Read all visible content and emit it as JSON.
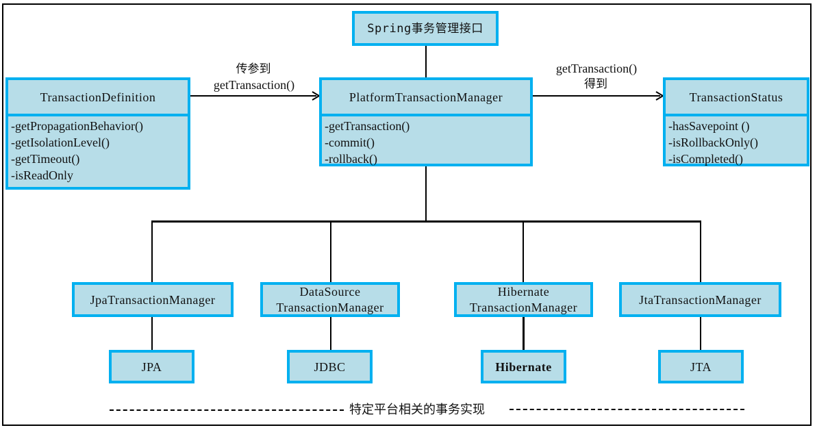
{
  "diagram": {
    "top_box": {
      "label": "Spring事务管理接口"
    },
    "definition": {
      "title": "TransactionDefinition",
      "members": [
        "-getPropagationBehavior()",
        "-getIsolationLevel()",
        "-getTimeout()",
        "-isReadOnly"
      ]
    },
    "manager": {
      "title": "PlatformTransactionManager",
      "members": [
        "-getTransaction()",
        "-commit()",
        "-rollback()"
      ]
    },
    "status": {
      "title": "TransactionStatus",
      "members": [
        "-hasSavepoint ()",
        "-isRollbackOnly()",
        "-isCompleted()"
      ]
    },
    "arrow_left": {
      "line1": "传参到",
      "line2": "getTransaction()"
    },
    "arrow_right": {
      "line1": "getTransaction()",
      "line2": "得到"
    },
    "implementations": [
      {
        "manager_line1": "JpaTransactionManager",
        "manager_line2": "",
        "platform": "JPA"
      },
      {
        "manager_line1": "DataSource",
        "manager_line2": "TransactionManager",
        "platform": "JDBC"
      },
      {
        "manager_line1": "Hibernate",
        "manager_line2": "TransactionManager",
        "platform": "Hibernate"
      },
      {
        "manager_line1": "JtaTransactionManager",
        "manager_line2": "",
        "platform": "JTA"
      }
    ],
    "footer": "特定平台相关的事务实现",
    "colors": {
      "box_fill": "#b7dde8",
      "box_border": "#00b0f0",
      "line": "#000000"
    }
  }
}
